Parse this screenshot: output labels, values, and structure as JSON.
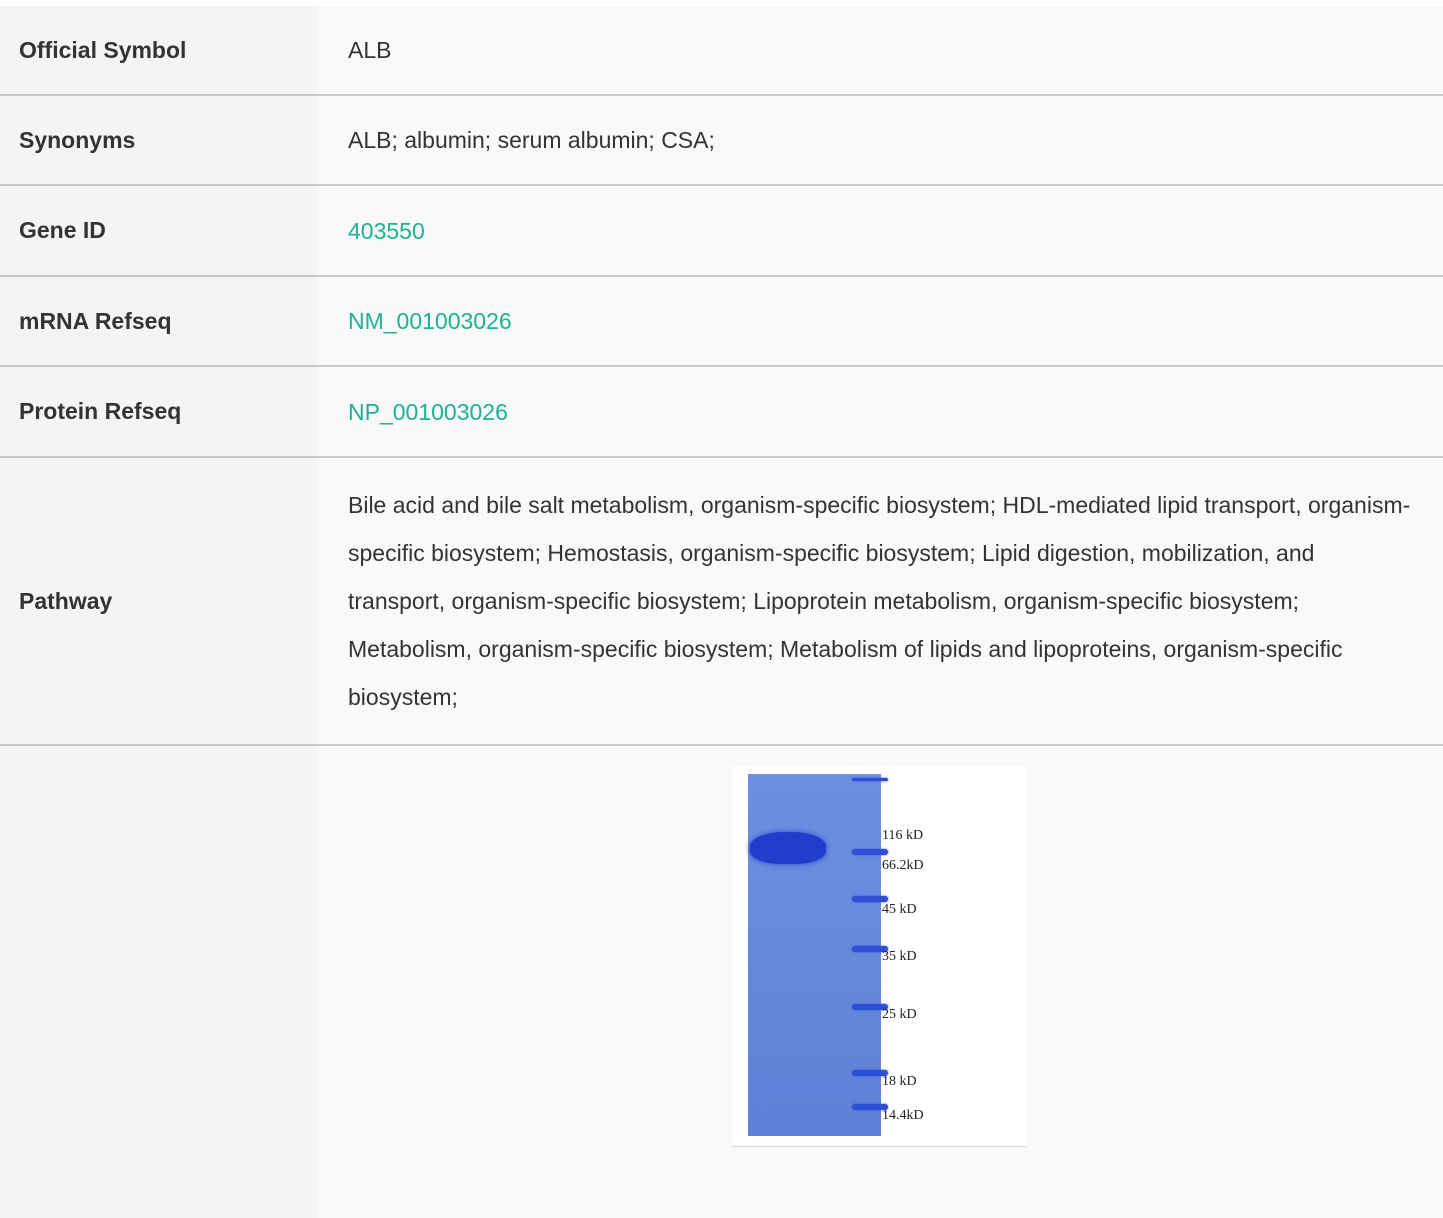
{
  "rows": [
    {
      "label": "Official Symbol",
      "value": "ALB"
    },
    {
      "label": "Synonyms",
      "value": "ALB; albumin; serum albumin; CSA;"
    },
    {
      "label": "Gene ID",
      "value": "403550"
    },
    {
      "label": "mRNA Refseq",
      "value": "NM_001003026"
    },
    {
      "label": "Protein Refseq",
      "value": "NP_001003026"
    },
    {
      "label": "Pathway",
      "value": "Bile acid and bile salt metabolism, organism-specific biosystem; HDL-mediated lipid transport, organism-specific biosystem; Hemostasis, organism-specific biosystem; Lipid digestion, mobilization, and transport, organism-specific biosystem; Lipoprotein metabolism, organism-specific biosystem; Metabolism, organism-specific biosystem; Metabolism of lipids and lipoproteins, organism-specific biosystem;"
    }
  ],
  "gel": {
    "markers": [
      "116 kD",
      "66.2kD",
      "45 kD",
      "35 kD",
      "25 kD",
      "18 kD",
      "14.4kD"
    ]
  },
  "colors": {
    "link": "#1ab394",
    "label_bg": "#f4f4f4",
    "value_bg": "#f9f9f9",
    "gel_bg": "#6688dc",
    "band": "#1f3ecb"
  }
}
